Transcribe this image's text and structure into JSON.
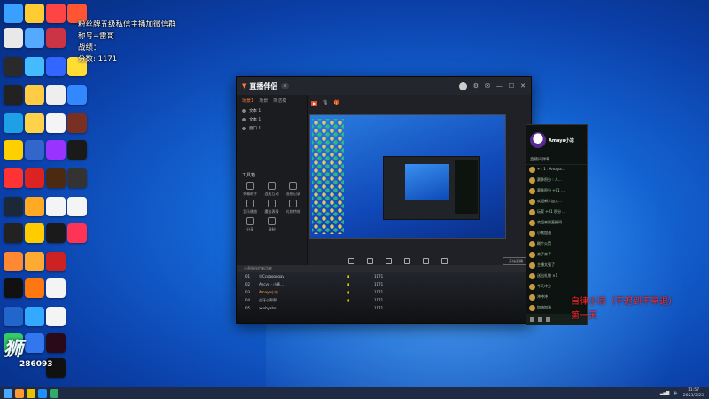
{
  "overlay": {
    "fan_line1": "粉丝牌五级私信主播加微信群",
    "fan_line2": "称号=雷哥",
    "fan_line3": "战绩：",
    "fan_line4": "分数: 1171"
  },
  "badge": {
    "logo": "狮",
    "number": "286093"
  },
  "app": {
    "brand": "直播伴侣",
    "tabs": [
      "场景1",
      "场景",
      "简洁模"
    ],
    "scenes": [
      "文本 1",
      "文本 1",
      "窗口 1"
    ],
    "tools_title": "工具箱",
    "tools": [
      "弹幕助手",
      "连麦互动",
      "直播记录",
      "音乐播放",
      "魔法表情",
      "礼物特效",
      "分享",
      "录制"
    ],
    "live_button": "开始直播",
    "notice": "小直播伴侣新功能",
    "ranks": [
      {
        "no": "01",
        "name": "乌Ccogogogay",
        "score": "1171"
      },
      {
        "no": "02",
        "name": "Ancyo · 小意…",
        "score": "1171"
      },
      {
        "no": "03",
        "name": "Amaya小凉",
        "score": "1171"
      },
      {
        "no": "04",
        "name": "虎牙小帮帮",
        "score": "1171"
      },
      {
        "no": "05",
        "name": "xxxbyahn",
        "score": "1171"
      }
    ]
  },
  "chat": {
    "name": "Amaya小凉",
    "tabs": "直播间弹幕",
    "messages": [
      "+ : 1 : Amaya…",
      "赛季积分 : 人…",
      "赛季积分  +01 …",
      "欢迎新人加入…",
      "玩家 +01 积分 …",
      "欢迎来到直播间",
      "小熊加油",
      "刷个火箭",
      "来了来了",
      "主播太强了",
      "送出礼物 ×1",
      "今天冲分",
      "冲冲冲",
      "加油加油"
    ]
  },
  "red_text": {
    "line1": "自律小凉（不迟到不早退）",
    "line2": "第一天"
  },
  "taskbar": {
    "time": "11:57",
    "date": "2023/3/23"
  }
}
